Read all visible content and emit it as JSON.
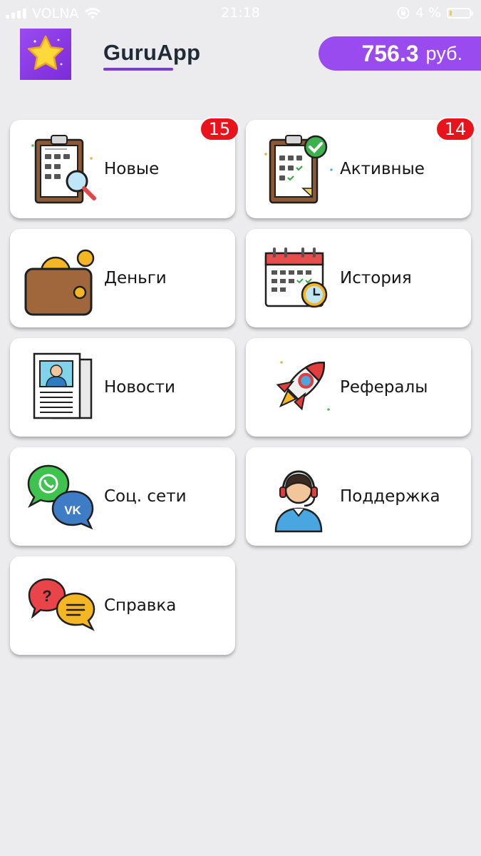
{
  "status_bar": {
    "carrier": "VOLNA",
    "time": "21:18",
    "battery": "4 %"
  },
  "header": {
    "app_name": "GuruApp",
    "balance_value": "756.3",
    "balance_currency": "руб."
  },
  "menu": [
    {
      "label": "Новые",
      "icon": "clipboard-search-icon",
      "badge": "15"
    },
    {
      "label": "Активные",
      "icon": "clipboard-check-icon",
      "badge": "14"
    },
    {
      "label": "Деньги",
      "icon": "wallet-icon"
    },
    {
      "label": "История",
      "icon": "calendar-clock-icon"
    },
    {
      "label": "Новости",
      "icon": "newspaper-icon"
    },
    {
      "label": "Рефералы",
      "icon": "rocket-icon"
    },
    {
      "label": "Соц. сети",
      "icon": "social-chat-icon"
    },
    {
      "label": "Поддержка",
      "icon": "support-agent-icon"
    },
    {
      "label": "Справка",
      "icon": "help-chat-icon"
    }
  ],
  "colors": {
    "accent": "#9a4bf0",
    "badge": "#e8131b",
    "background": "#ececee"
  }
}
